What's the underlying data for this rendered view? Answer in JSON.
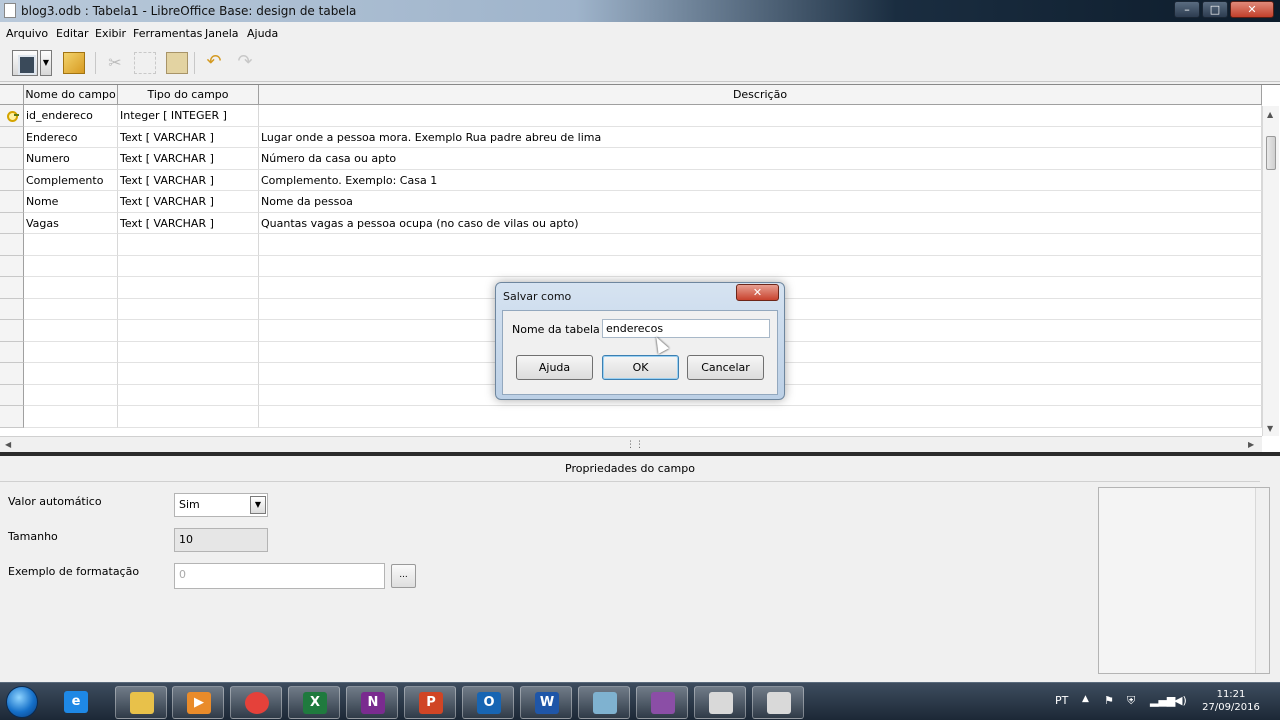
{
  "window": {
    "title": "blog3.odb : Tabela1 - LibreOffice Base: design de tabela",
    "min": "–",
    "max": "□",
    "close": "✕"
  },
  "menu": [
    "Arquivo",
    "Editar",
    "Exibir",
    "Ferramentas",
    "Janela",
    "Ajuda"
  ],
  "grid": {
    "headers": {
      "field_name": "Nome do campo",
      "field_type": "Tipo do campo",
      "description": "Descrição"
    },
    "rows": [
      {
        "name": "id_endereco",
        "type": "Integer [ INTEGER ]",
        "description": "",
        "primary_key": true
      },
      {
        "name": "Endereco",
        "type": "Text [ VARCHAR ]",
        "description": "Lugar onde a pessoa mora. Exemplo Rua padre abreu de lima"
      },
      {
        "name": "Numero",
        "type": "Text [ VARCHAR ]",
        "description": "Número da casa ou apto"
      },
      {
        "name": "Complemento",
        "type": "Text [ VARCHAR ]",
        "description": "Complemento. Exemplo: Casa 1"
      },
      {
        "name": "Nome",
        "type": "Text [ VARCHAR ]",
        "description": "Nome da pessoa"
      },
      {
        "name": "Vagas",
        "type": "Text [ VARCHAR ]",
        "description": "Quantas vagas a pessoa ocupa (no caso de vilas ou apto)"
      }
    ],
    "empty_rows": 10
  },
  "properties": {
    "title": "Propriedades do campo",
    "auto_value_label": "Valor automático",
    "auto_value": "Sim",
    "size_label": "Tamanho",
    "size_value": "10",
    "format_label": "Exemplo de formatação",
    "format_value": "0",
    "format_button": "..."
  },
  "dialog": {
    "title": "Salvar como",
    "close": "✕",
    "field_label": "Nome da tabela",
    "field_value": "enderecos",
    "help_button": "Ajuda",
    "ok_button": "OK",
    "cancel_button": "Cancelar"
  },
  "taskbar": {
    "apps": [
      {
        "name": "ie",
        "glyph": "e",
        "color": "#1e88e5"
      },
      {
        "name": "explorer",
        "glyph": "",
        "color": "#e8c14a"
      },
      {
        "name": "media-player",
        "glyph": "▶",
        "color": "#e98b2a"
      },
      {
        "name": "chrome",
        "glyph": "",
        "color": "#e5413a"
      },
      {
        "name": "excel",
        "glyph": "X",
        "color": "#1f7a3e"
      },
      {
        "name": "onenote",
        "glyph": "N",
        "color": "#7a2b8f"
      },
      {
        "name": "powerpoint",
        "glyph": "P",
        "color": "#d04525"
      },
      {
        "name": "outlook",
        "glyph": "O",
        "color": "#1765b3"
      },
      {
        "name": "word",
        "glyph": "W",
        "color": "#1f56a8"
      },
      {
        "name": "notepad",
        "glyph": "",
        "color": "#7fb2d0"
      },
      {
        "name": "libreoffice-base",
        "glyph": "",
        "color": "#8b4ea6"
      },
      {
        "name": "libreoffice-1",
        "glyph": "",
        "color": "#d9d9d9"
      },
      {
        "name": "libreoffice-2",
        "glyph": "",
        "color": "#d9d9d9"
      }
    ],
    "language": "PT",
    "time": "11:21",
    "date": "27/09/2016"
  },
  "colors": {
    "accent": "#3c7fb1",
    "key": "#d4a400",
    "close_red": "#c8432e"
  }
}
